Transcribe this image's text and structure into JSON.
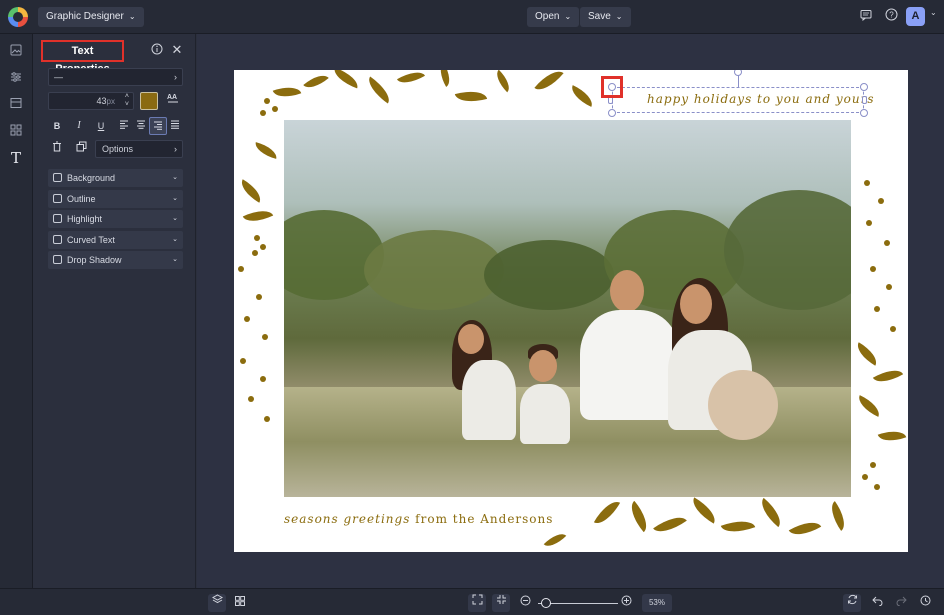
{
  "topbar": {
    "app_menu": "Graphic Designer",
    "open_label": "Open",
    "save_label": "Save",
    "avatar_initial": "A"
  },
  "panel": {
    "title": "Text Properties",
    "font_value": "—",
    "font_size": "43",
    "font_size_unit": "px",
    "text_color": "#8b6c0e",
    "bold": "B",
    "italic": "I",
    "underline": "U",
    "alignment_selected": "right",
    "options_label": "Options",
    "sections": [
      {
        "label": "Background"
      },
      {
        "label": "Outline"
      },
      {
        "label": "Highlight"
      },
      {
        "label": "Curved Text"
      },
      {
        "label": "Drop Shadow"
      }
    ]
  },
  "canvas": {
    "greeting_top": "happy holidays to you and yours",
    "greeting_bottom_script": "seasons greetings",
    "greeting_bottom_plain": " from the Andersons",
    "accent_color": "#8b6c0e"
  },
  "bottombar": {
    "zoom": "53%"
  }
}
